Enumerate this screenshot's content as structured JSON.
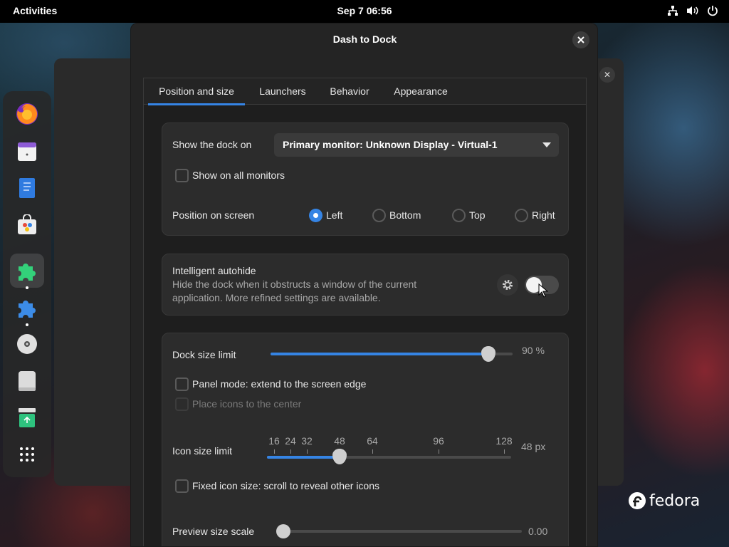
{
  "topbar": {
    "activities": "Activities",
    "clock": "Sep 7  06:56",
    "tray_icons": [
      "network-icon",
      "volume-icon",
      "power-icon"
    ]
  },
  "dock": {
    "apps": [
      {
        "name": "firefox-icon"
      },
      {
        "name": "calendar-icon"
      },
      {
        "name": "text-editor-icon"
      },
      {
        "name": "software-icon"
      },
      {
        "name": "extensions-icon",
        "active": true
      },
      {
        "name": "extension-manager-icon"
      },
      {
        "name": "rhythmbox-icon"
      },
      {
        "name": "disk-icon"
      },
      {
        "name": "trash-icon"
      },
      {
        "name": "app-grid-icon"
      }
    ]
  },
  "dialog": {
    "title": "Dash to Dock",
    "tabs": [
      "Position and size",
      "Launchers",
      "Behavior",
      "Appearance"
    ],
    "active_tab": "Position and size"
  },
  "monitor": {
    "label": "Show the dock on",
    "selected": "Primary monitor: Unknown Display - Virtual-1",
    "all_monitors_label": "Show on all monitors",
    "all_monitors_checked": false
  },
  "position": {
    "label": "Position on screen",
    "options": [
      "Left",
      "Bottom",
      "Top",
      "Right"
    ],
    "selected": "Left"
  },
  "autohide": {
    "title": "Intelligent autohide",
    "description_line1": "Hide the dock when it obstructs a window of the current",
    "description_line2": "application. More refined settings are available.",
    "enabled": false
  },
  "size": {
    "dock_size_label": "Dock size limit",
    "dock_size_value": 0.9,
    "dock_size_text": "90 %",
    "panel_mode_label": "Panel mode: extend to the screen edge",
    "center_icons_label": "Place icons to the center",
    "icon_size_label": "Icon size limit",
    "icon_size_marks": [
      "16",
      "24",
      "32",
      "48",
      "64",
      "96",
      "128"
    ],
    "icon_size_value": 48,
    "icon_size_text": "48 px",
    "fixed_icon_label": "Fixed icon size: scroll to reveal other icons",
    "preview_label": "Preview size scale",
    "preview_value": 0.0,
    "preview_text": "0.00"
  },
  "branding": {
    "logo_text": "fedora"
  },
  "colors": {
    "accent": "#3584e4",
    "dialog_bg": "#242424",
    "card_bg": "#2c2c2c"
  }
}
